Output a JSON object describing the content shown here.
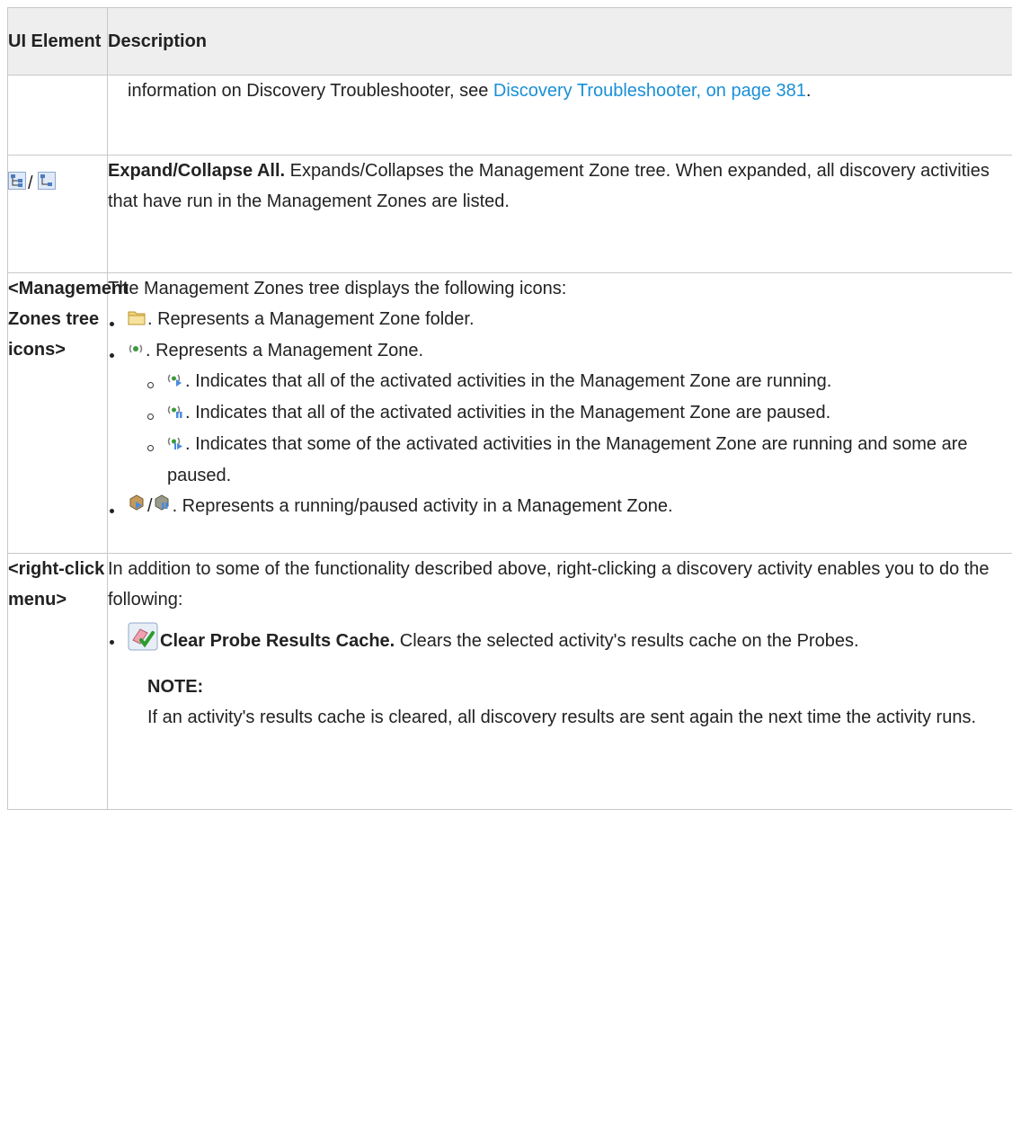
{
  "table": {
    "headers": {
      "col1": "UI Element",
      "col2": "Description"
    },
    "row1": {
      "text_before": "information on Discovery Troubleshooter, see ",
      "link_text": "Discovery Troubleshooter, on page 381",
      "text_after": "."
    },
    "row2": {
      "element_sep": "/",
      "title": "Expand/Collapse All.",
      "text": " Expands/Collapses the Management Zone tree. When expanded, all discovery activities that have run in the Management Zones are listed."
    },
    "row3": {
      "element": "<Management Zones tree icons>",
      "intro": "The Management Zones tree displays the following icons:",
      "bullet1": ". Represents a Management Zone folder.",
      "bullet2": ". Represents a Management Zone.",
      "sub1": ". Indicates that all of the activated activities in the Management Zone are running.",
      "sub2": ". Indicates that all of the activated activities in the Management Zone are paused.",
      "sub3": ". Indicates that some of the activated activities in the Management Zone are running and some are paused.",
      "bullet3_sep": "/",
      "bullet3": ". Represents a running/paused activity in a Management Zone."
    },
    "row4": {
      "element": "<right-click menu>",
      "intro": "In addition to some of the functionality described above, right-clicking a discovery activity enables you to do the following:",
      "bullet_title": "Clear Probe Results Cache.",
      "bullet_text": " Clears the selected activity's results cache on the Probes.",
      "note_title": "NOTE:",
      "note_text": "If an activity's results cache is cleared, all discovery results are sent again the next time the activity runs."
    }
  },
  "icons": {
    "expand_all": "expand-all-icon",
    "collapse_all": "collapse-all-icon",
    "folder": "folder-icon",
    "zone": "management-zone-icon",
    "running": "zone-running-icon",
    "paused": "zone-paused-icon",
    "mixed": "zone-mixed-icon",
    "activity_running": "activity-running-icon",
    "activity_paused": "activity-paused-icon",
    "clear_cache": "clear-cache-icon"
  },
  "colors": {
    "link": "#1a8fd6",
    "header_bg": "#eeeeee",
    "border": "#c8c8c8"
  }
}
